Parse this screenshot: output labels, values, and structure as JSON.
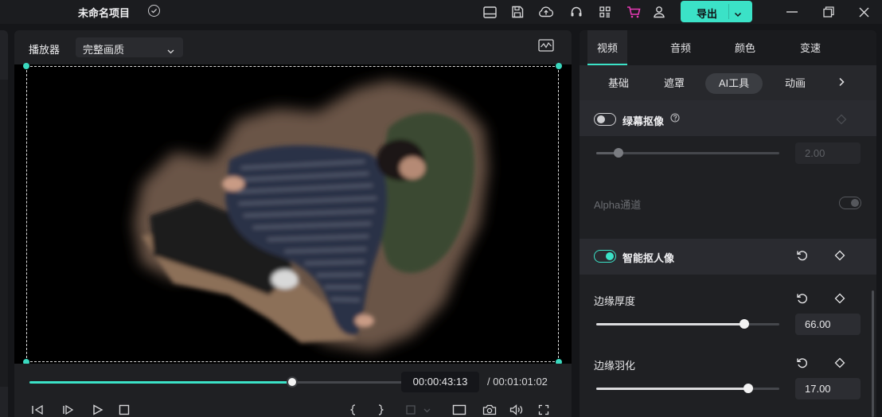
{
  "topbar": {
    "project_title": "未命名项目",
    "export_label": "导出",
    "icons": [
      "layout-icon",
      "save-icon",
      "cloud-upload-icon",
      "headset-icon",
      "grid-apps-icon",
      "cart-icon",
      "account-icon"
    ],
    "accent_color": "#3be2c7",
    "cart_color": "#e83ab6"
  },
  "player": {
    "title": "播放器",
    "quality": "完整画质",
    "current_time": "00:00:43:13",
    "total_time": "/ 00:01:01:02",
    "progress": 0.706
  },
  "inspector": {
    "tabs": [
      {
        "label": "视频",
        "active": true
      },
      {
        "label": "音频",
        "active": false
      },
      {
        "label": "颜色",
        "active": false
      },
      {
        "label": "变速",
        "active": false
      }
    ],
    "subtabs": [
      {
        "label": "基础",
        "active": false
      },
      {
        "label": "遮罩",
        "active": false
      },
      {
        "label": "AI工具",
        "active": true
      },
      {
        "label": "动画",
        "active": false
      }
    ],
    "chroma_key": {
      "label": "绿幕抠像",
      "enabled": false,
      "value": "2.00",
      "slider": 0.12
    },
    "alpha": {
      "label": "Alpha通道",
      "enabled": false
    },
    "smart_cutout": {
      "label": "智能抠人像",
      "enabled": true
    },
    "edge_thickness": {
      "label": "边缘厚度",
      "value": "66.00",
      "slider": 0.81
    },
    "edge_feather": {
      "label": "边缘羽化",
      "value": "17.00",
      "slider": 0.83
    }
  }
}
